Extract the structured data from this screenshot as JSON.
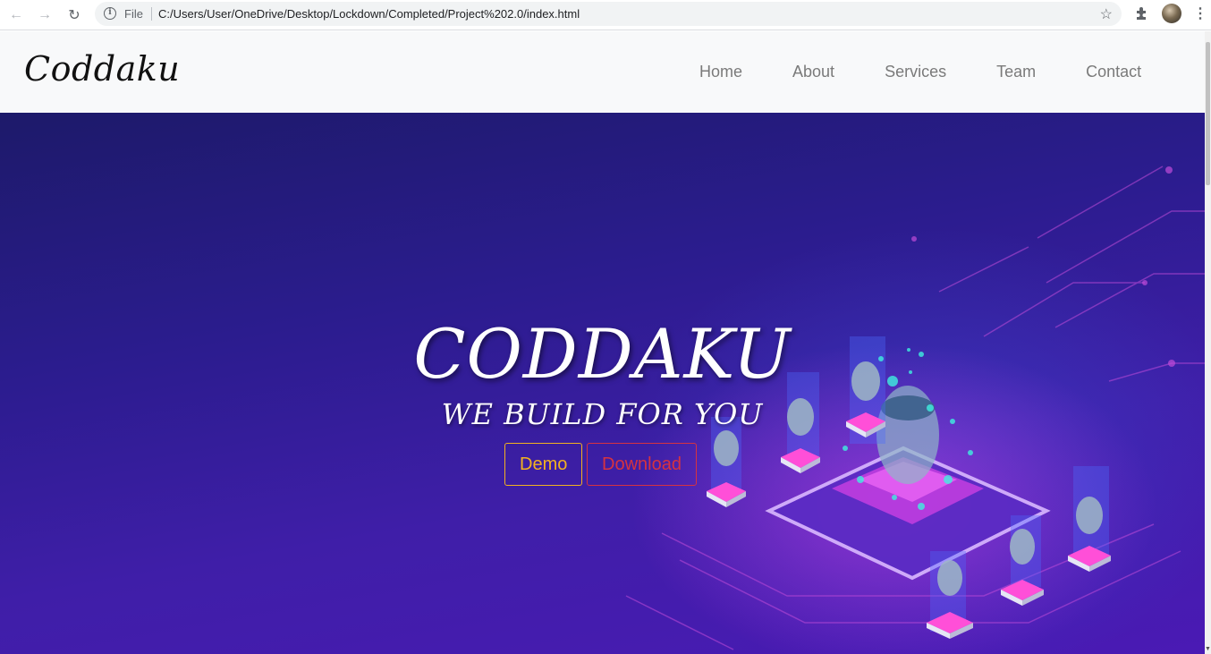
{
  "browser": {
    "file_label": "File",
    "url": "C:/Users/User/OneDrive/Desktop/Lockdown/Completed/Project%202.0/index.html"
  },
  "navbar": {
    "brand": "Coddaku",
    "links": [
      "Home",
      "About",
      "Services",
      "Team",
      "Contact"
    ]
  },
  "hero": {
    "title": "CODDAKU",
    "subtitle": "WE BUILD  FOR YOU",
    "buttons": {
      "demo": "Demo",
      "download": "Download"
    }
  },
  "colors": {
    "demo_accent": "#f3b21f",
    "download_accent": "#d63340",
    "navbar_bg": "#f8f9fa"
  },
  "icons": [
    "back-arrow-icon",
    "forward-arrow-icon",
    "reload-icon",
    "info-icon",
    "star-icon",
    "puzzle-icon",
    "kebab-menu-icon"
  ]
}
